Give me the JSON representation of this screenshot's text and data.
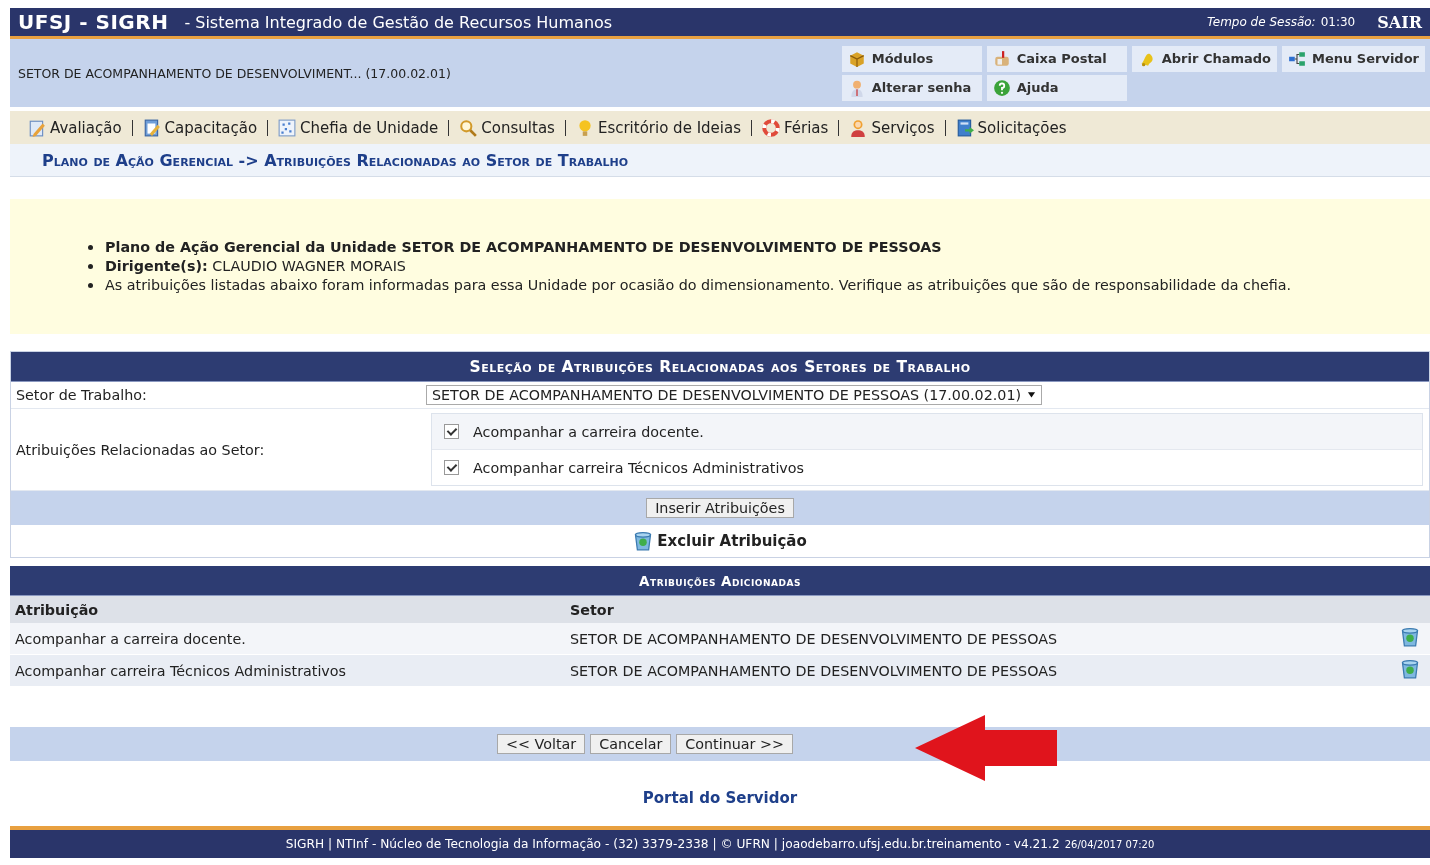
{
  "header": {
    "system": "UFSJ - SIGRH",
    "subtitle": "- Sistema Integrado de Gestão de Recursos Humanos",
    "session_label": "Tempo de Sessão:",
    "session_time": "01:30",
    "logout": "SAIR"
  },
  "unit": "SETOR DE ACOMPANHAMENTO DE DESENVOLVIMENT... (17.00.02.01)",
  "shortcuts": [
    {
      "label": "Módulos"
    },
    {
      "label": "Caixa Postal"
    },
    {
      "label": "Abrir Chamado"
    },
    {
      "label": "Menu Servidor"
    },
    {
      "label": "Alterar senha"
    },
    {
      "label": "Ajuda"
    }
  ],
  "menu": [
    {
      "label": "Avaliação"
    },
    {
      "label": "Capacitação"
    },
    {
      "label": "Chefia de Unidade"
    },
    {
      "label": "Consultas"
    },
    {
      "label": "Escritório de Ideias"
    },
    {
      "label": "Férias"
    },
    {
      "label": "Serviços"
    },
    {
      "label": "Solicitações"
    }
  ],
  "breadcrumb": "Plano de Ação Gerencial -> Atribuições Relacionadas ao Setor de Trabalho",
  "notice": [
    {
      "text": "Plano de Ação Gerencial da Unidade SETOR DE ACOMPANHAMENTO DE DESENVOLVIMENTO DE PESSOAS",
      "bold": true
    },
    {
      "text": "**Dirigente(s):** CLAUDIO WAGNER MORAIS",
      "bold": false
    },
    {
      "text": "As atribuições listadas abaixo foram informadas para essa Unidade por ocasião do dimensionamento. Verifique as atribuições que são de responsabilidade da chefia.",
      "bold": false
    }
  ],
  "form": {
    "caption": "Seleção de Atribuições Relacionadas aos Setores de Trabalho",
    "sector_label": "Setor de Trabalho:",
    "sector_value": "SETOR DE ACOMPANHAMENTO DE DESENVOLVIMENTO DE PESSOAS (17.00.02.01)",
    "assignments_label": "Atribuições Relacionadas ao Setor:",
    "assignments": [
      {
        "label": "Acompanhar a carreira docente.",
        "checked": true
      },
      {
        "label": "Acompanhar carreira Técnicos Administrativos",
        "checked": true
      }
    ],
    "insert_button": "Inserir Atribuições",
    "delete_legend": "Excluir Atribuição"
  },
  "added": {
    "caption": "Atribuições Adicionadas",
    "columns": [
      "Atribuição",
      "Setor"
    ],
    "rows": [
      [
        "Acompanhar a carreira docente.",
        "SETOR DE ACOMPANHAMENTO DE DESENVOLVIMENTO DE PESSOAS"
      ],
      [
        "Acompanhar carreira Técnicos Administrativos",
        "SETOR DE ACOMPANHAMENTO DE DESENVOLVIMENTO DE PESSOAS"
      ]
    ]
  },
  "buttons": [
    "<< Voltar",
    "Cancelar",
    "Continuar >>"
  ],
  "portal_link": "Portal do Servidor",
  "footer": {
    "text": "SIGRH | NTInf - Núcleo de Tecnologia da Informação - (32) 3379-2338 | © UFRN | joaodebarro.ufsj.edu.br.treinamento - v4.21.2",
    "timestamp": "26/04/2017 07:20"
  }
}
